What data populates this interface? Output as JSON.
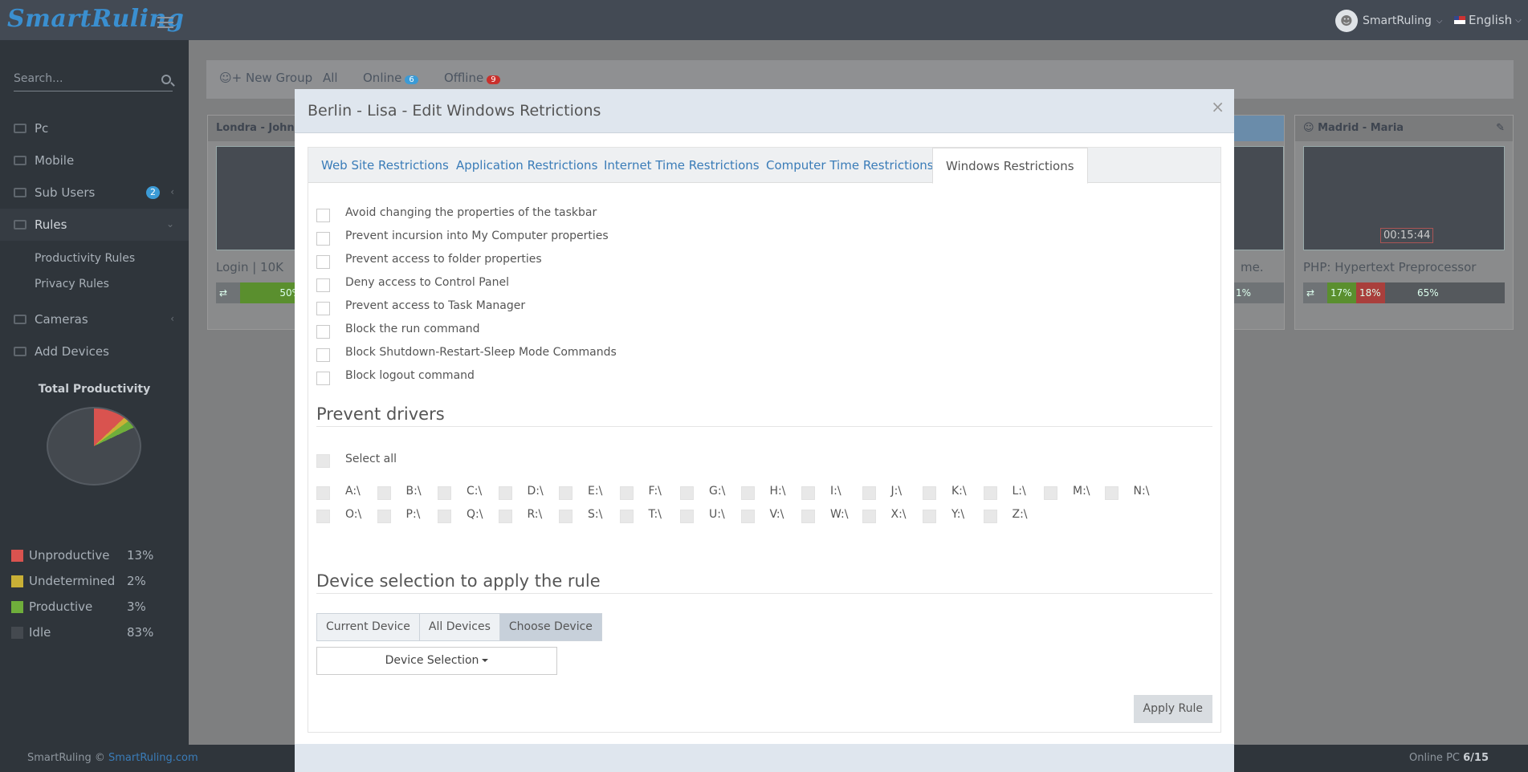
{
  "app": {
    "logo": "SmartRuling",
    "user_name": "SmartRuling",
    "language": "English"
  },
  "sidebar": {
    "search_placeholder": "Search...",
    "items": [
      {
        "label": "Pc",
        "icon": "monitor-icon"
      },
      {
        "label": "Mobile",
        "icon": "mobile-icon"
      },
      {
        "label": "Sub Users",
        "icon": "user-icon",
        "badge": "2"
      },
      {
        "label": "Rules",
        "icon": "wrench-icon"
      },
      {
        "label": "Cameras",
        "icon": "camera-icon"
      },
      {
        "label": "Add Devices",
        "icon": "plus-icon"
      }
    ],
    "rules_sub": [
      "Productivity Rules",
      "Privacy Rules"
    ],
    "total_productivity_title": "Total Productivity",
    "productivity": [
      {
        "label": "Unproductive",
        "pct": "13%",
        "color": "#d9534f"
      },
      {
        "label": "Undetermined",
        "pct": "2%",
        "color": "#c9b036"
      },
      {
        "label": "Productive",
        "pct": "3%",
        "color": "#6fae3b"
      },
      {
        "label": "Idle",
        "pct": "83%",
        "color": "#44494f"
      }
    ]
  },
  "main_tabs": {
    "new_group": "New Group",
    "all": "All",
    "online": "Online",
    "online_count": "6",
    "offline": "Offline",
    "offline_count": "9"
  },
  "cards": {
    "left_title": "Londra - John",
    "left_line": "Login | 10K",
    "left_bar": "50%",
    "right_title": "Madrid - Maria",
    "right_timer": "00:15:44",
    "right_line": "PHP: Hypertext Preprocessor",
    "right_bar": [
      "17%",
      "18%",
      "65%"
    ],
    "mid_line": "me.",
    "mid_bar": "1%"
  },
  "modal": {
    "title": "Berlin - Lisa - Edit Windows Retrictions",
    "close": "×",
    "tabs": [
      "Web Site Restrictions",
      "Application Restrictions",
      "Internet Time Restrictions",
      "Computer Time Restrictions",
      "Windows Restrictions"
    ],
    "restrictions": [
      "Avoid changing the properties of the taskbar",
      "Prevent incursion into My Computer properties",
      "Prevent access to folder properties",
      "Deny access to Control Panel",
      "Prevent access to Task Manager",
      "Block the run command",
      "Block Shutdown-Restart-Sleep Mode Commands",
      "Block logout command"
    ],
    "drivers_title": "Prevent drivers",
    "select_all": "Select all",
    "drives_row1": [
      "A:\\",
      "B:\\",
      "C:\\",
      "D:\\",
      "E:\\",
      "F:\\",
      "G:\\",
      "H:\\",
      "I:\\",
      "J:\\",
      "K:\\",
      "L:\\",
      "M:\\",
      "N:\\"
    ],
    "drives_row2": [
      "O:\\",
      "P:\\",
      "Q:\\",
      "R:\\",
      "S:\\",
      "T:\\",
      "U:\\",
      "V:\\",
      "W:\\",
      "X:\\",
      "Y:\\",
      "Z:\\"
    ],
    "device_title": "Device selection to apply the rule",
    "device_buttons": [
      "Current Device",
      "All Devices",
      "Choose Device"
    ],
    "device_selection": "Device Selection",
    "apply": "Apply Rule"
  },
  "footer": {
    "copy": "SmartRuling ©",
    "link": "SmartRuling.com",
    "online_pc_label": "Online PC",
    "online_pc_value": "6/15"
  }
}
